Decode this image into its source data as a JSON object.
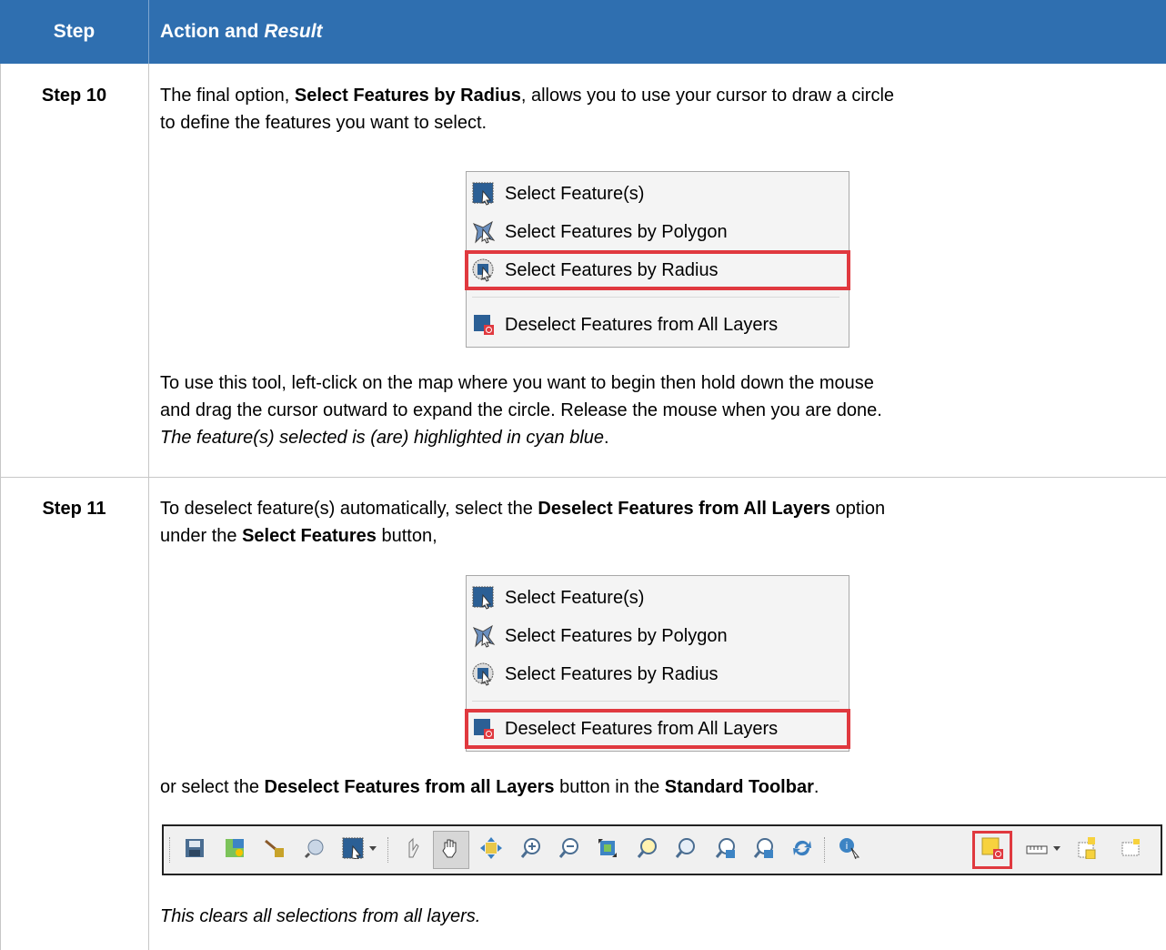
{
  "header": {
    "step": "Step",
    "action": "Action and ",
    "result": "Result"
  },
  "step10": {
    "label": "Step 10",
    "p1a": "The final option, ",
    "p1b": "Select Features by Radius",
    "p1c": ", allows you to use your cursor to draw a circle",
    "p1d": "to define the features you want to select.",
    "p2a": "To use this tool, left-click on the map where you want to begin then hold down the mouse",
    "p2b": "and drag the cursor outward to expand the circle. Release the mouse when you are done.",
    "p2c": "The feature(s) selected is (are) highlighted in cyan blue",
    "p2d": "."
  },
  "step11": {
    "label": "Step 11",
    "p1a": "To deselect feature(s) automatically, select the ",
    "p1b": "Deselect Features from All Layers",
    "p1c": " option",
    "p1d": "under the ",
    "p1e": "Select Features",
    "p1f": " button,",
    "p2a": "or select the ",
    "p2b": "Deselect Features from all Layers",
    "p2c": " button in the ",
    "p2d": "Standard Toolbar",
    "p2e": ".",
    "p3": "This clears all selections from all layers."
  },
  "menu": {
    "items": [
      "Select Feature(s)",
      "Select Features by Polygon",
      "Select Features by Radius",
      "Deselect Features from All Layers"
    ]
  },
  "toolbar_icons": [
    "save-icon",
    "new-project-icon",
    "brush-icon",
    "identify-map-icon",
    "select-feature-icon",
    "pan-to-selection-icon",
    "pan-hand-icon",
    "pan-map-icon",
    "zoom-in-icon",
    "zoom-out-icon",
    "zoom-full-icon",
    "zoom-to-selection-icon",
    "zoom-to-layer-icon",
    "zoom-last-icon",
    "zoom-next-icon",
    "refresh-icon",
    "identify-features-icon",
    "deselect-features-icon",
    "measure-icon",
    "new-bookmark-icon",
    "show-bookmarks-icon"
  ],
  "colors": {
    "header": "#2f6fb0",
    "highlight": "#e0393f"
  }
}
